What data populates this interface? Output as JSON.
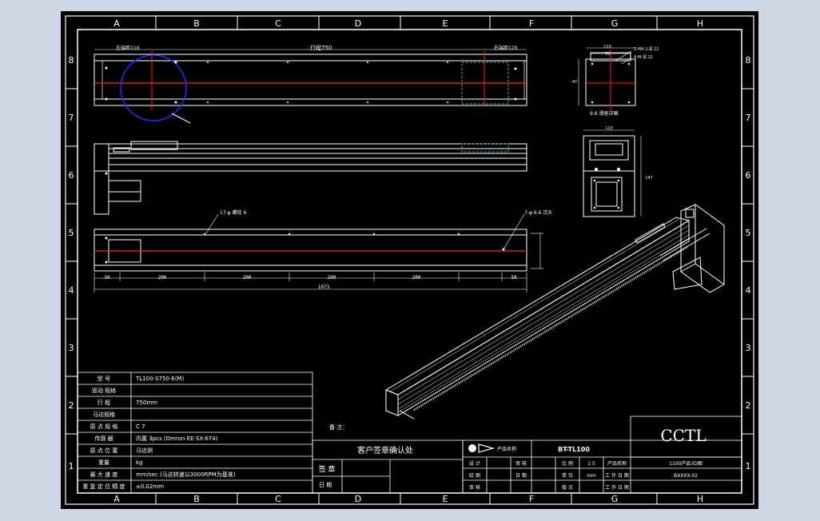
{
  "colors": {
    "background": "#000000",
    "frame": "#ffffff",
    "centerline": "#ff2020",
    "detail_circle": "#2030ff",
    "hidden": "#2ab5c8",
    "page_margin": "#cfd6e5"
  },
  "zones": {
    "columns": [
      "A",
      "B",
      "C",
      "D",
      "E",
      "F",
      "G",
      "H"
    ],
    "rows": [
      "8",
      "7",
      "6",
      "5",
      "4",
      "3",
      "2",
      "1"
    ]
  },
  "top_view": {
    "dim_left": "左端距110",
    "dim_stroke": "行程750",
    "dim_right": "右端距120"
  },
  "front_view": {
    "note_left": "17-φ 螺栓 6",
    "note_right": "7-φ 6.6 沉头",
    "dims": [
      "30",
      "200",
      "200",
      "200",
      "200",
      "50"
    ],
    "total": "1073"
  },
  "end_view": {
    "dim_top": "110",
    "dim_inner": "70",
    "note_1": "2-M4 ∅深 12",
    "note_2": "4-M 深 12",
    "dim_side": "47",
    "caption": "9.6 滑座详图",
    "section_dim_top": "110",
    "section_dim_side": "147"
  },
  "spec_table": {
    "rows": [
      {
        "label": "型 号",
        "value": "TL100-S750-E(M)"
      },
      {
        "label": "驱动 规格",
        "value": ""
      },
      {
        "label": "行 程",
        "value": "750mm"
      },
      {
        "label": "马达规格",
        "value": ""
      },
      {
        "label": "原 点 规 格",
        "value": "C 7"
      },
      {
        "label": "传感 器",
        "value": "内置 3pcs (Omron EE-SX-674)"
      },
      {
        "label": "原 点 位 置",
        "value": "马达侧"
      },
      {
        "label": "重量",
        "value": "kg"
      },
      {
        "label": "最 大 速 度",
        "value": "mm/sec  (马达转速以3000RPM为基准)"
      },
      {
        "label": "重 复 定 位 精 度",
        "value": "±0.02mm"
      }
    ]
  },
  "notes_label": "备 注：",
  "confirm_block": {
    "header": "客户签章确认处",
    "sign_label": "签 章",
    "date_label": "日 期"
  },
  "title_block": {
    "item_name_label": "产品名称",
    "product_code": "BT-TL100",
    "company": "CCTL",
    "drawing_desc": "1100产品3D图",
    "drawing_no": "BXXXX-02",
    "rows": [
      [
        "设 计",
        "审 核",
        "比 例",
        "1:5",
        "产品名称"
      ],
      [
        "绘 图",
        "日 期",
        "单 位",
        "mm",
        "工 作 日 期"
      ],
      [
        "审 核",
        "",
        "版 次",
        "",
        "工 作 日 期"
      ]
    ]
  }
}
